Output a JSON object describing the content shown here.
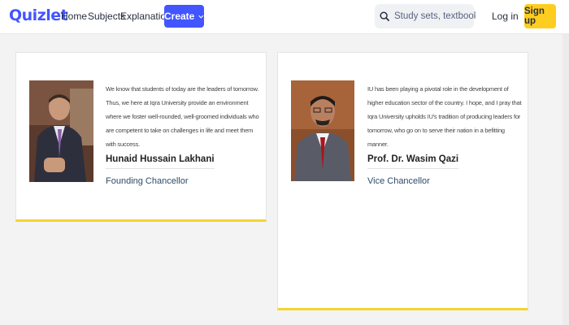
{
  "header": {
    "logo": "Quizlet",
    "nav": [
      "Home",
      "Subjects",
      "Explanations"
    ],
    "create_label": "Create",
    "search_placeholder": "Study sets, textbooks, ...",
    "login_label": "Log in",
    "signup_label": "Sign up",
    "brand_color": "#4255ff",
    "signup_color": "#ffcd1f"
  },
  "cards": [
    {
      "quote": "We know that students of today are the leaders of tomorrow. Thus, we here at Iqra University provide an environment where we foster well-rounded, well-groomed individuals who are competent to take on challenges in life and meet them with success.",
      "name": "Hunaid Hussain Lakhani",
      "title": "Founding Chancellor"
    },
    {
      "quote": "IU has been playing a pivotal role in the development of higher education sector of the country. I hope, and I pray that Iqra University upholds IU's tradition of producing leaders for tomorrow, who go on to serve their nation in a befitting manner.",
      "name": "Prof. Dr. Wasim Qazi",
      "title": "Vice Chancellor"
    }
  ],
  "accent_color": "#f3d532"
}
